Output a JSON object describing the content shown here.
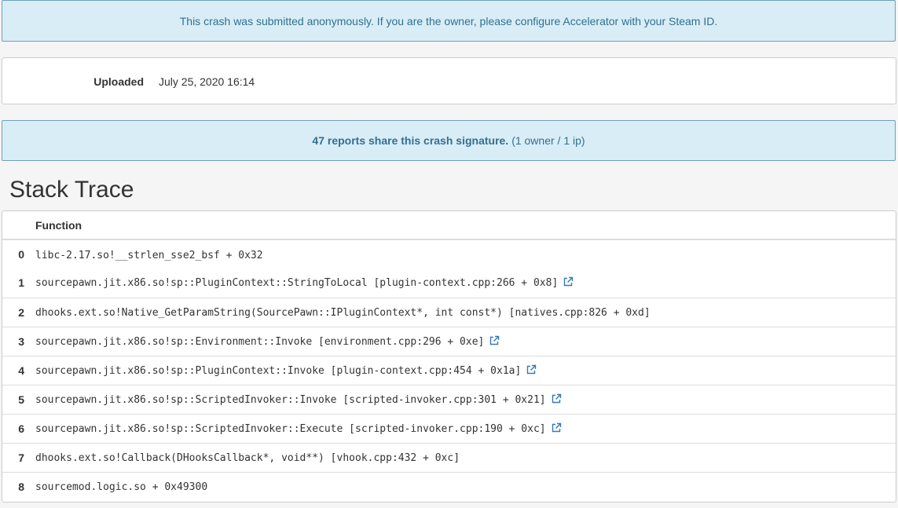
{
  "alerts": {
    "anonymous": "This crash was submitted anonymously. If you are the owner, please configure Accelerator with your Steam ID.",
    "signature_strong": "47 reports share this crash signature.",
    "signature_detail": "(1 owner / 1 ip)"
  },
  "uploaded": {
    "label": "Uploaded",
    "value": "July 25, 2020 16:14"
  },
  "stack_trace": {
    "heading": "Stack Trace",
    "column_function": "Function",
    "frames": [
      {
        "index": "0",
        "function": "libc-2.17.so!__strlen_sse2_bsf + 0x32",
        "has_link": false
      },
      {
        "index": "1",
        "function": "sourcepawn.jit.x86.so!sp::PluginContext::StringToLocal [plugin-context.cpp:266 + 0x8]",
        "has_link": true
      },
      {
        "index": "2",
        "function": "dhooks.ext.so!Native_GetParamString(SourcePawn::IPluginContext*, int const*) [natives.cpp:826 + 0xd]",
        "has_link": false
      },
      {
        "index": "3",
        "function": "sourcepawn.jit.x86.so!sp::Environment::Invoke [environment.cpp:296 + 0xe]",
        "has_link": true
      },
      {
        "index": "4",
        "function": "sourcepawn.jit.x86.so!sp::PluginContext::Invoke [plugin-context.cpp:454 + 0x1a]",
        "has_link": true
      },
      {
        "index": "5",
        "function": "sourcepawn.jit.x86.so!sp::ScriptedInvoker::Invoke [scripted-invoker.cpp:301 + 0x21]",
        "has_link": true
      },
      {
        "index": "6",
        "function": "sourcepawn.jit.x86.so!sp::ScriptedInvoker::Execute [scripted-invoker.cpp:190 + 0xc]",
        "has_link": true
      },
      {
        "index": "7",
        "function": "dhooks.ext.so!Callback(DHooksCallback*, void**) [vhook.cpp:432 + 0xc]",
        "has_link": false
      },
      {
        "index": "8",
        "function": "sourcemod.logic.so + 0x49300",
        "has_link": false
      }
    ]
  },
  "colors": {
    "alert_bg": "#d9edf7",
    "alert_text": "#31708f",
    "link": "#337ab7"
  },
  "icons": {
    "external_link": "external-link-icon"
  }
}
